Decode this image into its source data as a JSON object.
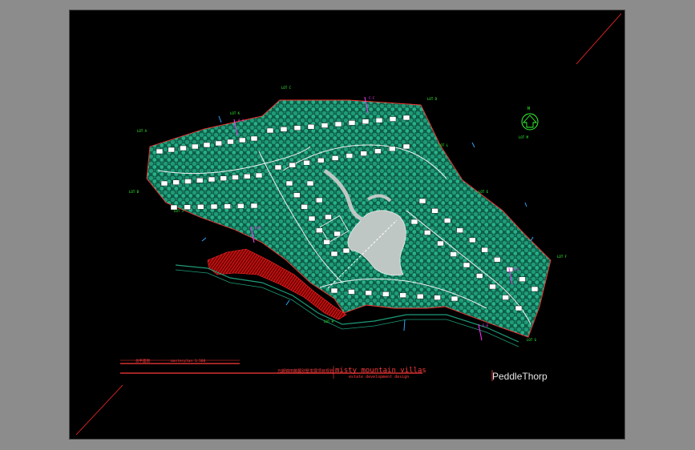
{
  "title_block": {
    "chinese_title": "元朗锦田薇麓别墅发展项目规划",
    "project_name": "misty  mountain  villas",
    "subtitle": "estate  development  design",
    "firm": "PeddleThorp",
    "plan_label": "总平面图",
    "scale_text": "masterplan   1:500"
  },
  "north_arrow": {
    "label": "N"
  },
  "colors": {
    "background": "#000000",
    "vegetation": "#1f9b78",
    "boundary": "#ff3030",
    "roads": "#ffffff",
    "labels": "#33ff33",
    "section_marks": "#ff33ff",
    "water": "#2aa8ff"
  },
  "site_labels": [
    "LOT A",
    "LOT B",
    "LOT C",
    "LOT D",
    "LOT E",
    "LOT F",
    "LOT G",
    "LOT H",
    "LOT J",
    "LOT K",
    "LOT L",
    "LOT M"
  ],
  "section_marks": [
    "A-A",
    "B-B",
    "C-C",
    "D-D",
    "E-E"
  ]
}
